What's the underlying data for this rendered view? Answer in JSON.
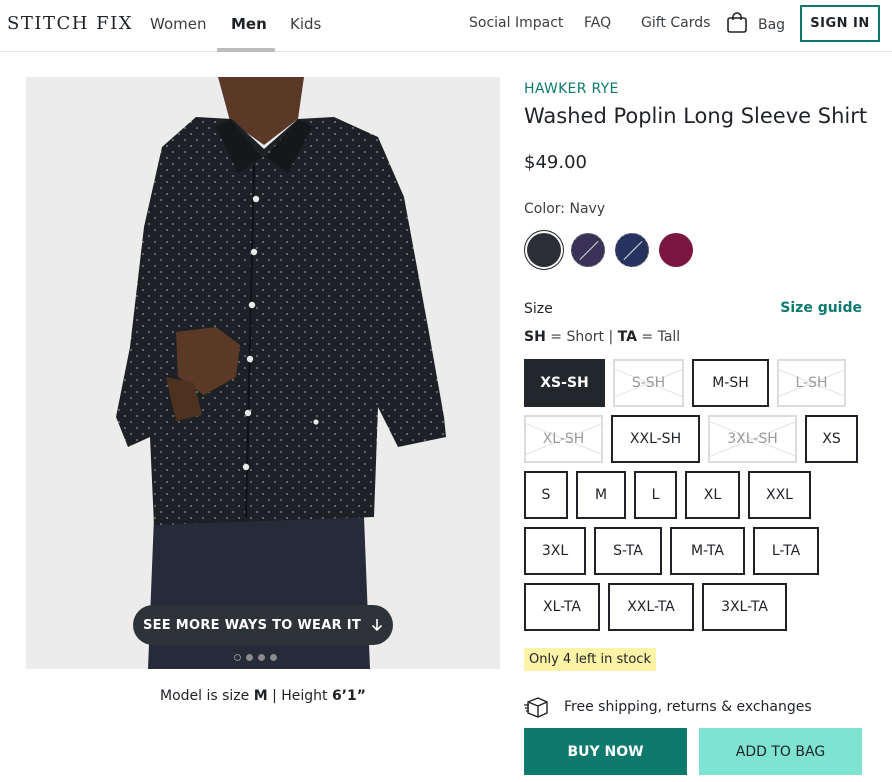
{
  "header": {
    "logo": "STITCH FIX",
    "nav": [
      {
        "label": "Women",
        "active": false
      },
      {
        "label": "Men",
        "active": true
      },
      {
        "label": "Kids",
        "active": false
      }
    ],
    "utility": {
      "social_impact": "Social Impact",
      "faq": "FAQ",
      "gift_cards": "Gift Cards",
      "bag": "Bag",
      "sign_in": "SIGN IN"
    }
  },
  "gallery": {
    "see_more": "SEE MORE WAYS TO WEAR IT",
    "image_count": 4,
    "active_index": 0,
    "model_text_prefix": "Model is size ",
    "model_size": "M",
    "model_text_middle": " | Height ",
    "model_height": "6’1”"
  },
  "product": {
    "brand": "HAWKER RYE",
    "title": "Washed Poplin Long Sleeve Shirt",
    "price": "$49.00",
    "color_label": "Color:",
    "color_value": "Navy",
    "swatches": [
      {
        "color": "#2b2e35",
        "selected": true,
        "available": true
      },
      {
        "color": "#3a3357",
        "selected": false,
        "available": false
      },
      {
        "color": "#27325f",
        "selected": false,
        "available": false
      },
      {
        "color": "#7b1640",
        "selected": false,
        "available": true
      }
    ],
    "size_label": "Size",
    "size_guide": "Size guide",
    "legend": {
      "sh": "SH",
      "sh_text": " = Short | ",
      "ta": "TA",
      "ta_text": " = Tall"
    },
    "sizes": [
      {
        "label": "XS-SH",
        "state": "selected"
      },
      {
        "label": "S-SH",
        "state": "oos"
      },
      {
        "label": "M-SH",
        "state": "available"
      },
      {
        "label": "L-SH",
        "state": "oos"
      },
      {
        "label": "XL-SH",
        "state": "oos"
      },
      {
        "label": "XXL-SH",
        "state": "available"
      },
      {
        "label": "3XL-SH",
        "state": "oos"
      },
      {
        "label": "XS",
        "state": "available"
      },
      {
        "label": "S",
        "state": "available"
      },
      {
        "label": "M",
        "state": "available"
      },
      {
        "label": "L",
        "state": "available"
      },
      {
        "label": "XL",
        "state": "available"
      },
      {
        "label": "XXL",
        "state": "available"
      },
      {
        "label": "3XL",
        "state": "available"
      },
      {
        "label": "S-TA",
        "state": "available"
      },
      {
        "label": "M-TA",
        "state": "available"
      },
      {
        "label": "L-TA",
        "state": "available"
      },
      {
        "label": "XL-TA",
        "state": "available"
      },
      {
        "label": "XXL-TA",
        "state": "available"
      },
      {
        "label": "3XL-TA",
        "state": "available"
      }
    ],
    "stock_notice": "Only 4 left in stock",
    "shipping_text": "Free shipping, returns & exchanges",
    "buy_now": "BUY NOW",
    "add_to_bag": "ADD TO BAG"
  },
  "colors": {
    "accent": "#0e7a6e",
    "accent_light": "#7fe3d2",
    "highlight": "#fcf3a6"
  }
}
